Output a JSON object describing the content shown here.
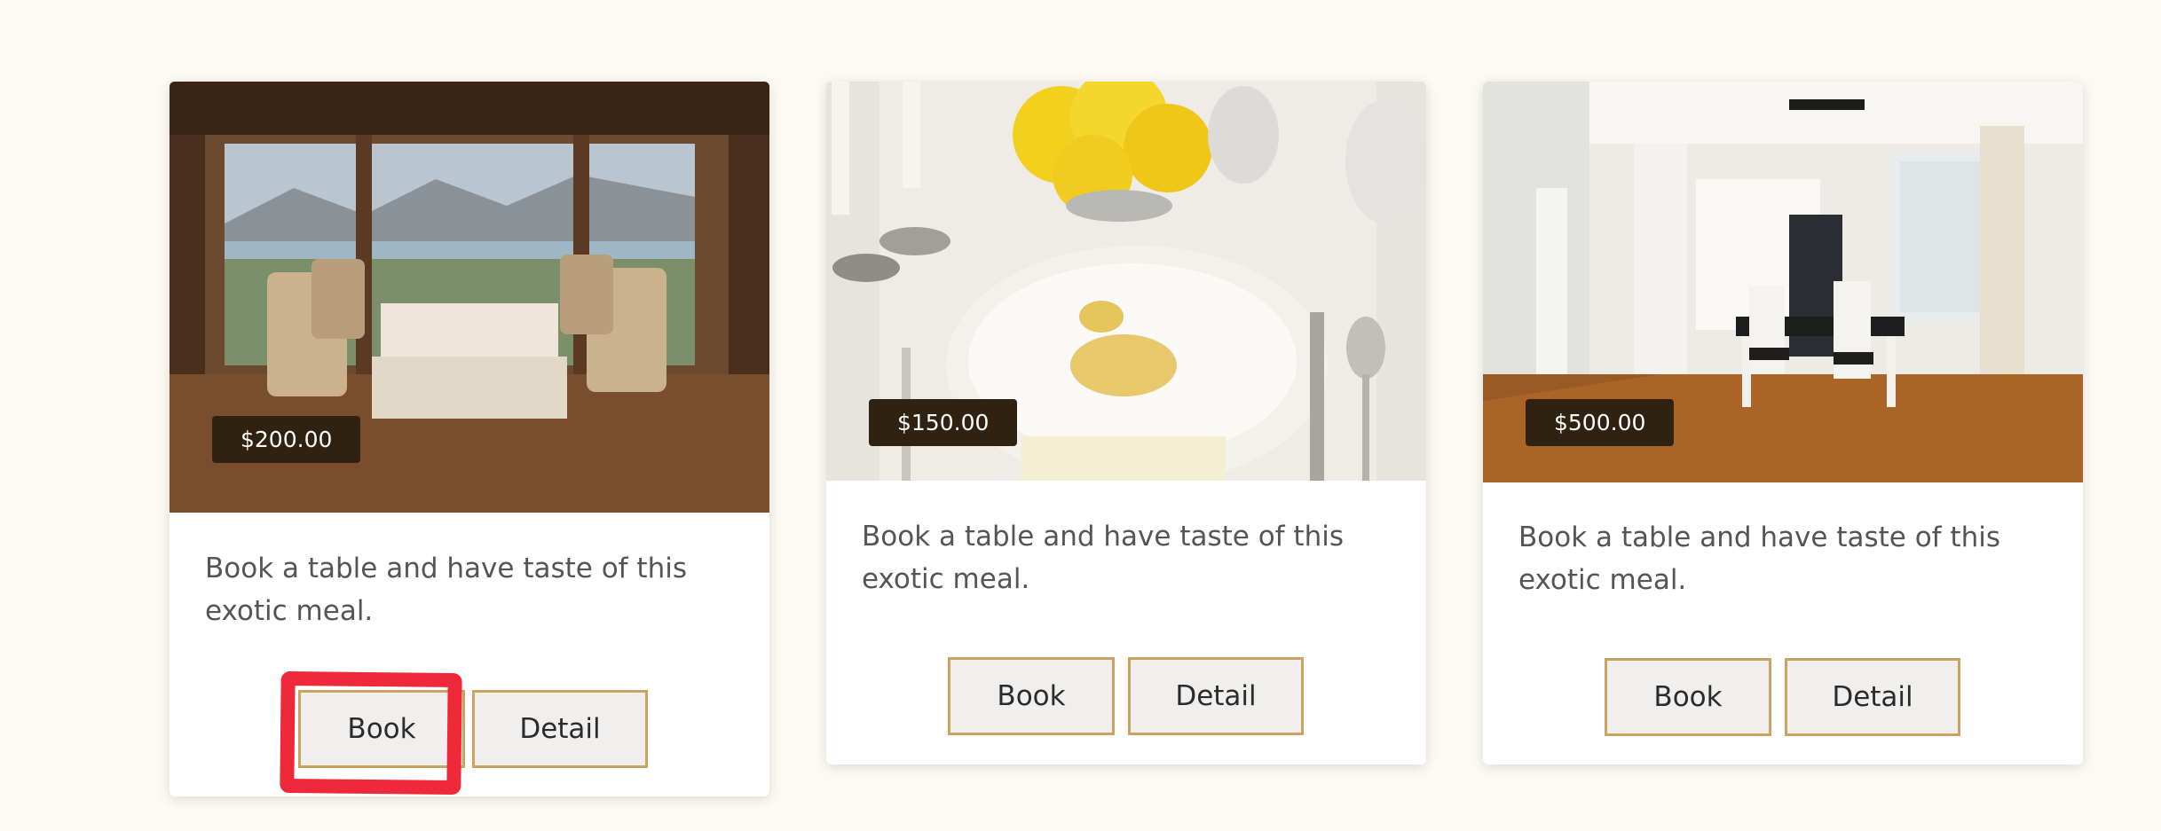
{
  "cards": [
    {
      "price": "$200.00",
      "description": "Book a table and have taste of this exotic meal.",
      "book_label": "Book",
      "detail_label": "Detail",
      "image": "restaurant-dining-room-harbor-view"
    },
    {
      "price": "$150.00",
      "description": "Book a table and have taste of this exotic meal.",
      "book_label": "Book",
      "detail_label": "Detail",
      "image": "table-setting-yellow-roses"
    },
    {
      "price": "$500.00",
      "description": "Book a table and have taste of this exotic meal.",
      "book_label": "Book",
      "detail_label": "Detail",
      "image": "modern-dining-room"
    }
  ],
  "colors": {
    "page_bg": "#fdf9f3",
    "price_badge": "#2f2210",
    "button_border": "#c9a35f",
    "button_bg": "#f0efed",
    "highlight": "#ee2a3a"
  }
}
